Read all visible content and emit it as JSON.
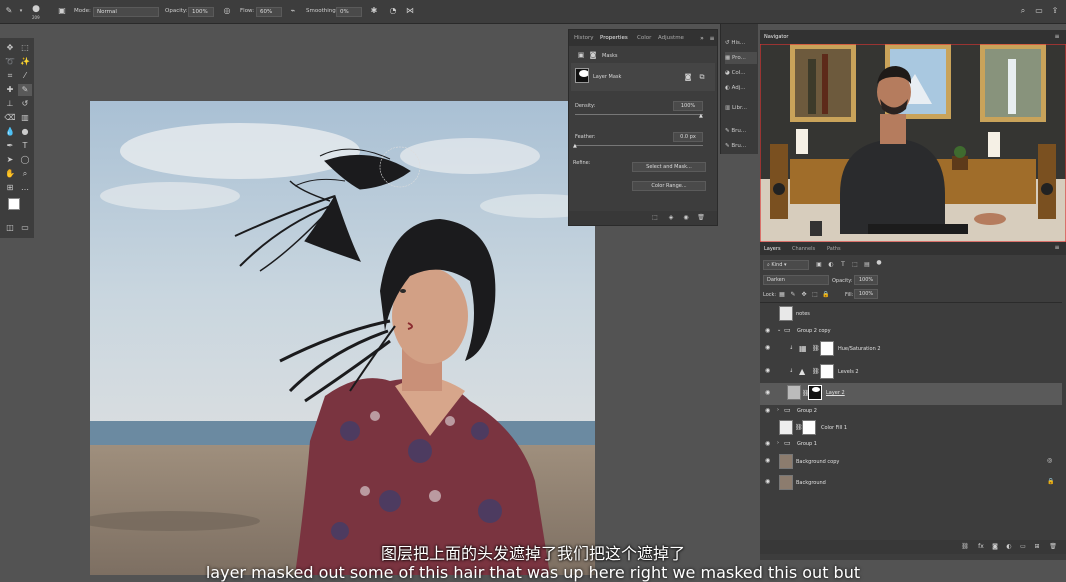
{
  "options_bar": {
    "brush_size": "209",
    "mode_label": "Mode:",
    "mode_value": "Normal",
    "opacity_label": "Opacity:",
    "opacity_value": "100%",
    "flow_label": "Flow:",
    "flow_value": "60%",
    "smoothing_label": "Smoothing:",
    "smoothing_value": "0%"
  },
  "properties_panel": {
    "tabs": [
      "History",
      "Properties",
      "Color",
      "Adjustme"
    ],
    "masks_label": "Masks",
    "layer_mask_label": "Layer Mask",
    "density_label": "Density:",
    "density_value": "100%",
    "feather_label": "Feather:",
    "feather_value": "0.0 px",
    "refine_label": "Refine:",
    "select_mask_button": "Select and Mask...",
    "color_range_button": "Color Range..."
  },
  "dock": {
    "items": [
      "His...",
      "Pro...",
      "Col...",
      "Adj...",
      "Libr...",
      "Bru...",
      "Bru..."
    ]
  },
  "navigator": {
    "title": "Navigator"
  },
  "layers_panel": {
    "tabs": [
      "Layers",
      "Channels",
      "Paths"
    ],
    "kind_label": "Kind",
    "blend_mode": "Darken",
    "opacity_label": "Opacity:",
    "opacity_value": "100%",
    "lock_label": "Lock:",
    "fill_label": "Fill:",
    "fill_value": "100%",
    "layers": [
      {
        "name": "notes"
      },
      {
        "name": "Group 2 copy"
      },
      {
        "name": "Hue/Saturation 2"
      },
      {
        "name": "Levels 2"
      },
      {
        "name": "Layer 2"
      },
      {
        "name": "Group 2"
      },
      {
        "name": "Color Fill 1"
      },
      {
        "name": "Group 1"
      },
      {
        "name": "Background copy"
      },
      {
        "name": "Background"
      }
    ]
  },
  "subtitles": {
    "chinese": "图层把上面的头发遮掉了我们把这个遮掉了",
    "english": "layer masked out some of this hair that was up here right we masked this out but"
  },
  "colors": {
    "panel": "#3d3d3d",
    "workspace": "#535353",
    "selected_layer": "#5a5a5a"
  }
}
